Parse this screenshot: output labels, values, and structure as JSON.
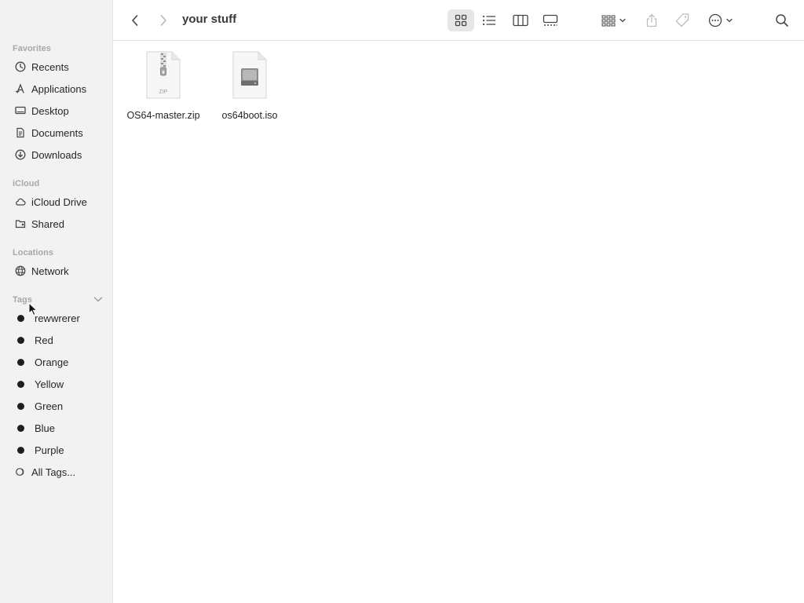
{
  "window": {
    "title": "your stuff"
  },
  "sidebar": {
    "favorites_title": "Favorites",
    "favorites": [
      {
        "label": "Recents",
        "icon": "clock-icon"
      },
      {
        "label": "Applications",
        "icon": "applications-icon"
      },
      {
        "label": "Desktop",
        "icon": "desktop-icon"
      },
      {
        "label": "Documents",
        "icon": "document-icon"
      },
      {
        "label": "Downloads",
        "icon": "download-icon"
      }
    ],
    "icloud_title": "iCloud",
    "icloud": [
      {
        "label": "iCloud Drive",
        "icon": "cloud-icon"
      },
      {
        "label": "Shared",
        "icon": "shared-folder-icon"
      }
    ],
    "locations_title": "Locations",
    "locations": [
      {
        "label": "Network",
        "icon": "globe-icon"
      }
    ],
    "tags_title": "Tags",
    "tags": [
      {
        "label": "rewwrerer"
      },
      {
        "label": "Red"
      },
      {
        "label": "Orange"
      },
      {
        "label": "Yellow"
      },
      {
        "label": "Green"
      },
      {
        "label": "Blue"
      },
      {
        "label": "Purple"
      }
    ],
    "all_tags_label": "All Tags..."
  },
  "files": [
    {
      "name": "OS64-master.zip",
      "type": "zip",
      "badge": "ZIP"
    },
    {
      "name": "os64boot.iso",
      "type": "disk-image"
    }
  ],
  "colors": {
    "sidebar_bg": "#f2f2f2",
    "tag_dot": "#1e1e1e",
    "selected_view_bg": "#e6e6e6"
  }
}
